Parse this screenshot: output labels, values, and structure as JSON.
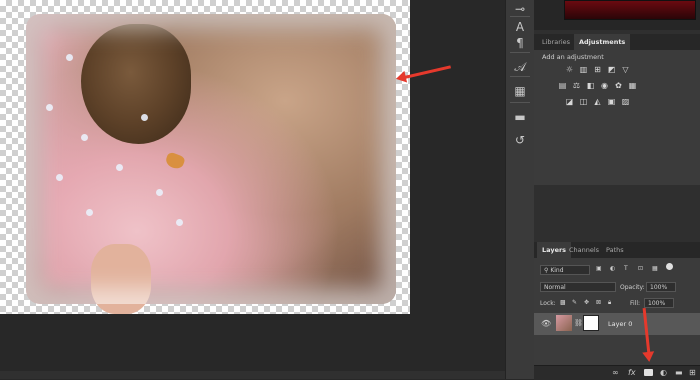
{
  "adjustments_panel": {
    "tabs": [
      {
        "label": "Libraries",
        "active": false
      },
      {
        "label": "Adjustments",
        "active": true
      }
    ],
    "header": "Add an adjustment"
  },
  "layers_panel": {
    "tabs": [
      {
        "label": "Layers",
        "active": true
      },
      {
        "label": "Channels",
        "active": false
      },
      {
        "label": "Paths",
        "active": false
      }
    ],
    "filter_kind": "Kind",
    "blend_mode": "Normal",
    "opacity_label": "Opacity:",
    "opacity_value": "100%",
    "lock_label": "Lock:",
    "fill_label": "Fill:",
    "fill_value": "100%",
    "layer_name": "Layer 0"
  },
  "bottom_bar": {
    "fx_label": "fx"
  },
  "colors": {
    "accent_arrow": "#e5392c",
    "panel_bg": "#3b3b3b",
    "selected_layer": "#585858"
  },
  "icons": [
    "link-icon",
    "fx-icon",
    "add-mask-icon",
    "adjustment-layer-icon",
    "new-group-icon",
    "new-layer-icon"
  ]
}
